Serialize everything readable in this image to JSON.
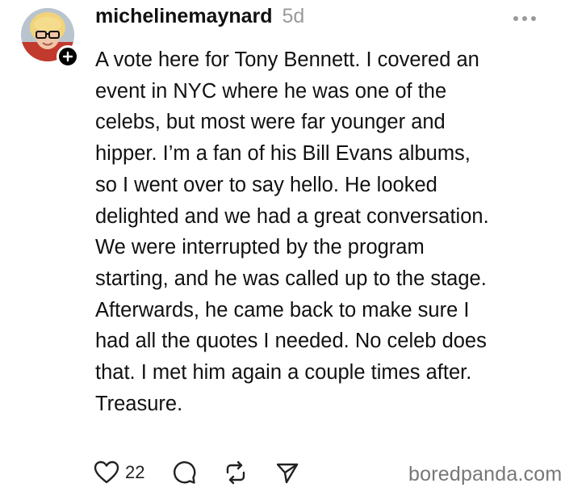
{
  "post": {
    "username": "michelinemaynard",
    "timestamp": "5d",
    "text": "A vote here for Tony Bennett. I covered an\nevent in NYC where he was one of the\ncelebs, but most were far younger and\nhipper. I’m a fan of his Bill Evans albums,\nso I went over to say hello. He looked\ndelighted and we had a great conversation.\nWe were interrupted by the program\nstarting, and he was called up to the stage.\nAfterwards, he came back to make sure I\nhad all the quotes I needed. No celeb does\nthat. I met him again a couple times after.\nTreasure.",
    "like_count": "22"
  },
  "icons": {
    "like": "heart-icon",
    "reply": "comment-bubble-icon",
    "repost": "repost-icon",
    "share": "send-icon",
    "more": "more-options-icon",
    "follow": "plus-icon"
  },
  "watermark": "boredpanda.com"
}
